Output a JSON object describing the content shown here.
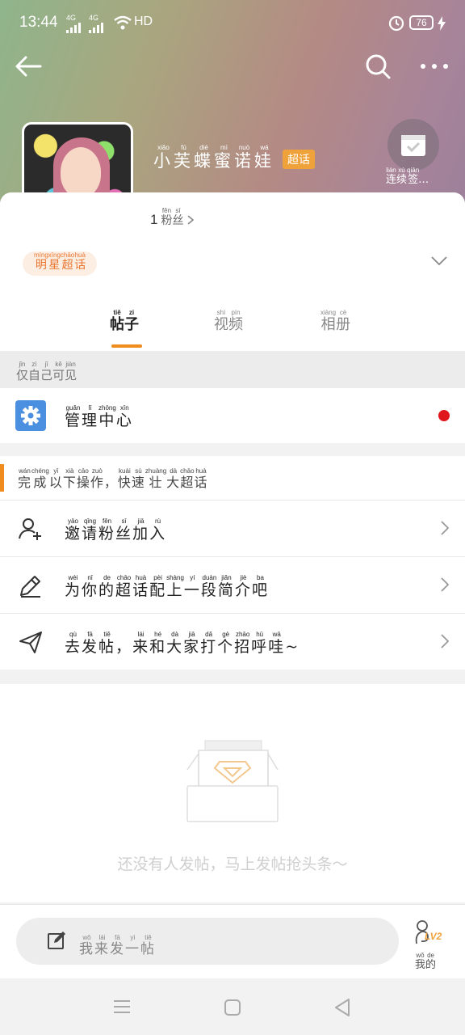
{
  "status": {
    "time": "13:44",
    "signal1": "4G",
    "signal2": "4G",
    "network": "HD",
    "battery": "76"
  },
  "header": {
    "name": "小芙蝶蜜诺娃",
    "name_pinyin": [
      "xiǎo",
      "fú",
      "dié",
      "mì",
      "nuò",
      "wá"
    ],
    "tag": "超话",
    "checkin_label": "连续签…",
    "checkin_pinyin": [
      "lián",
      "xù",
      "qiān"
    ]
  },
  "profile": {
    "fans_count": "1",
    "fans_label": "粉丝",
    "fans_pinyin": [
      "fěn",
      "sī"
    ],
    "badge": "明星超话",
    "badge_pinyin": [
      "míng",
      "xīng",
      "chāo",
      "huà"
    ]
  },
  "tabs": [
    {
      "label": "帖子",
      "pinyin": [
        "tiě",
        "zi"
      ]
    },
    {
      "label": "视频",
      "pinyin": [
        "shì",
        "pín"
      ]
    },
    {
      "label": "相册",
      "pinyin": [
        "xiàng",
        "cè"
      ]
    }
  ],
  "private_notice": {
    "text": "仅自己可见",
    "pinyin": [
      "jǐn",
      "zì",
      "jǐ",
      "kě",
      "jiàn"
    ]
  },
  "management": {
    "label": "管理中心",
    "pinyin": [
      "guǎn",
      "lǐ",
      "zhōng",
      "xīn"
    ]
  },
  "tasks_header": {
    "text": "完成以下操作，快速壮大超话",
    "pinyin": [
      "wán",
      "chéng",
      "yǐ",
      "xià",
      "cāo",
      "zuò",
      "",
      "kuài",
      "sù",
      "zhuàng",
      "dà",
      "chāo",
      "huà"
    ]
  },
  "tasks": [
    {
      "label": "邀请粉丝加入",
      "pinyin": [
        "yāo",
        "qǐng",
        "fěn",
        "sī",
        "jiā",
        "rù"
      ],
      "icon": "user-add-icon"
    },
    {
      "label": "为你的超话配上一段简介吧",
      "pinyin": [
        "wèi",
        "nǐ",
        "de",
        "chāo",
        "huà",
        "pèi",
        "shàng",
        "yí",
        "duàn",
        "jiǎn",
        "jiè",
        "ba"
      ],
      "icon": "pencil-icon"
    },
    {
      "label": "去发帖，来和大家打个招呼哇~",
      "pinyin": [
        "qù",
        "fā",
        "tiě",
        "",
        "lái",
        "hé",
        "dà",
        "jiā",
        "dǎ",
        "gè",
        "zhāo",
        "hū",
        "wā",
        ""
      ],
      "icon": "send-icon"
    }
  ],
  "empty_state": {
    "text": "还没有人发帖，马上发帖抢头条～"
  },
  "composer": {
    "placeholder": "我来发一帖",
    "pinyin": [
      "wǒ",
      "lái",
      "fā",
      "yì",
      "tiě"
    ]
  },
  "mine": {
    "label": "我的",
    "pinyin": [
      "wǒ",
      "de"
    ],
    "level": "LV2"
  },
  "colors": {
    "accent": "#f08b1d",
    "tag_orange": "#f0a23a",
    "gear_blue": "#4b8fe0",
    "alert_red": "#e0161d"
  }
}
